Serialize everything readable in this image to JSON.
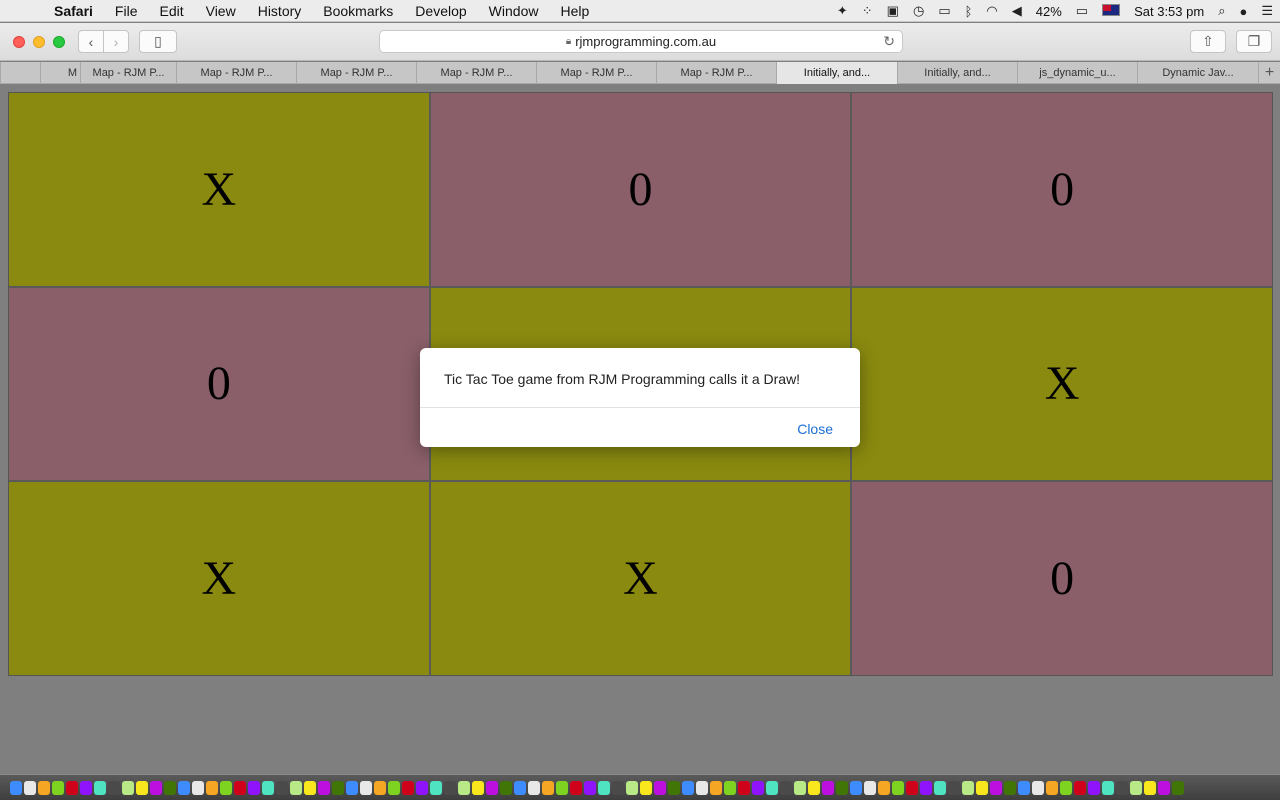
{
  "menubar": {
    "app": "Safari",
    "items": [
      "File",
      "Edit",
      "View",
      "History",
      "Bookmarks",
      "Develop",
      "Window",
      "Help"
    ],
    "battery": "42%",
    "clock": "Sat 3:53 pm"
  },
  "toolbar": {
    "url": "rjmprogramming.com.au"
  },
  "tabs": [
    {
      "label": "M",
      "active": false
    },
    {
      "label": "Map - RJM P...",
      "active": false
    },
    {
      "label": "Map - RJM P...",
      "active": false
    },
    {
      "label": "Map - RJM P...",
      "active": false
    },
    {
      "label": "Map - RJM P...",
      "active": false
    },
    {
      "label": "Map - RJM P...",
      "active": false
    },
    {
      "label": "Map - RJM P...",
      "active": false
    },
    {
      "label": "Initially, and...",
      "active": true
    },
    {
      "label": "Initially, and...",
      "active": false
    },
    {
      "label": "js_dynamic_u...",
      "active": false
    },
    {
      "label": "Dynamic Jav...",
      "active": false
    }
  ],
  "colors": {
    "x_cell": "#8a8a10",
    "o_cell": "#8a5f6a"
  },
  "board": {
    "cells": [
      "X",
      "0",
      "0",
      "0",
      "",
      "X",
      "X",
      "X",
      "0"
    ],
    "cell_colors": [
      "x",
      "o",
      "o",
      "o",
      "x",
      "x",
      "x",
      "x",
      "o"
    ]
  },
  "dialog": {
    "message": "Tic Tac Toe game from RJM Programming calls it a Draw!",
    "close_label": "Close"
  }
}
